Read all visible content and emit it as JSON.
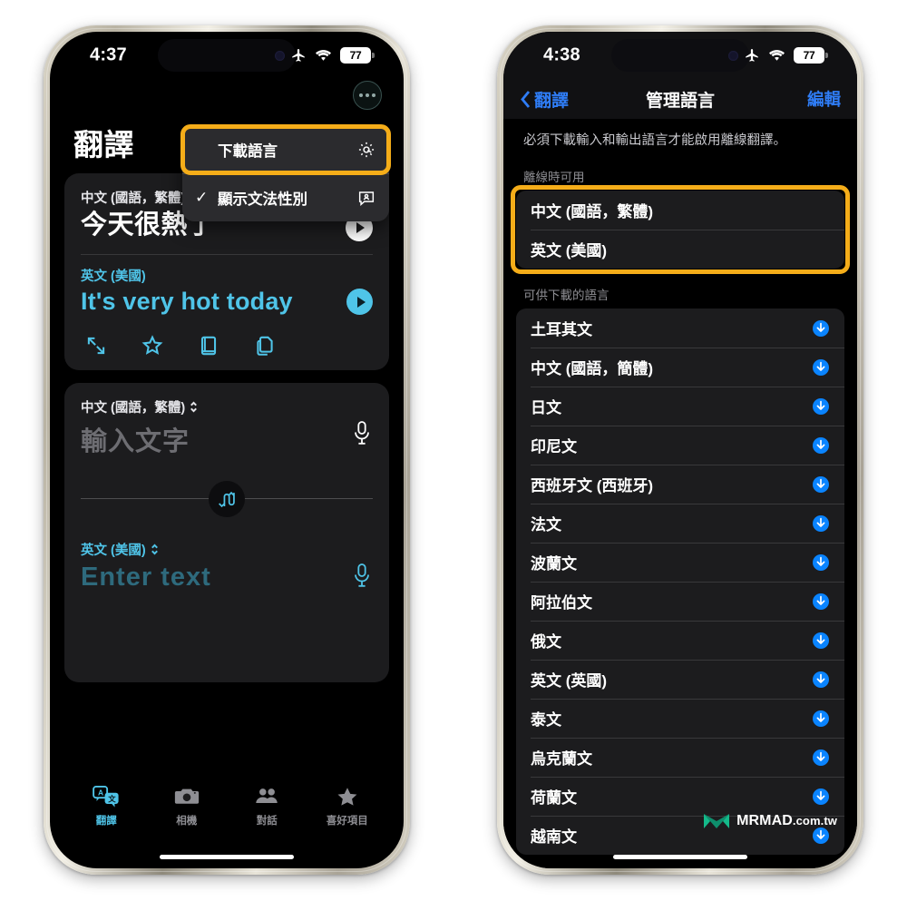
{
  "left_phone": {
    "status_bar": {
      "time": "4:37",
      "airplane_icon": "airplane-icon",
      "wifi_icon": "wifi-icon",
      "battery": "77"
    },
    "app": {
      "title": "翻譯",
      "more_button": "more-options-icon",
      "context_menu": {
        "items": [
          {
            "label": "下載語言",
            "icon": "gear-icon",
            "checked": false,
            "highlighted": true
          },
          {
            "label": "顯示文法性別",
            "icon": "speech-person-icon",
            "checked": true,
            "check_glyph": "✓"
          }
        ]
      },
      "result_card": {
        "source_language": "中文 (國語，繁體)",
        "source_text": "今天很熱了",
        "source_play_icon": "play-icon",
        "target_language": "英文 (美國)",
        "target_text": "It's very hot today",
        "target_play_icon": "play-icon",
        "actions": [
          "expand-icon",
          "star-icon",
          "dictionary-icon",
          "copy-icon"
        ]
      },
      "input_card": {
        "source_language": "中文 (國語，繁體)",
        "source_placeholder": "輸入文字",
        "source_mic_icon": "microphone-icon",
        "swap_icon": "swap-languages-icon",
        "target_language": "英文 (美國)",
        "target_placeholder": "Enter text",
        "target_mic_icon": "microphone-icon"
      },
      "tabs": [
        {
          "label": "翻譯",
          "icon": "translate-icon",
          "active": true
        },
        {
          "label": "相機",
          "icon": "camera-icon",
          "active": false
        },
        {
          "label": "對話",
          "icon": "conversation-icon",
          "active": false
        },
        {
          "label": "喜好項目",
          "icon": "star-icon",
          "active": false
        }
      ]
    }
  },
  "right_phone": {
    "status_bar": {
      "time": "4:38",
      "airplane_icon": "airplane-icon",
      "wifi_icon": "wifi-icon",
      "battery": "77"
    },
    "nav": {
      "back_label": "翻譯",
      "back_icon": "chevron-left-icon",
      "title": "管理語言",
      "edit_label": "編輯"
    },
    "notice": "必須下載輸入和輸出語言才能啟用離線翻譯。",
    "offline_section": {
      "header": "離線時可用",
      "highlighted": true,
      "items": [
        {
          "label": "中文 (國語，繁體)"
        },
        {
          "label": "英文 (美國)"
        }
      ]
    },
    "available_section": {
      "header": "可供下載的語言",
      "items": [
        {
          "label": "土耳其文",
          "icon": "download-icon"
        },
        {
          "label": "中文 (國語，簡體)",
          "icon": "download-icon"
        },
        {
          "label": "日文",
          "icon": "download-icon"
        },
        {
          "label": "印尼文",
          "icon": "download-icon"
        },
        {
          "label": "西班牙文 (西班牙)",
          "icon": "download-icon"
        },
        {
          "label": "法文",
          "icon": "download-icon"
        },
        {
          "label": "波蘭文",
          "icon": "download-icon"
        },
        {
          "label": "阿拉伯文",
          "icon": "download-icon"
        },
        {
          "label": "俄文",
          "icon": "download-icon"
        },
        {
          "label": "英文 (英國)",
          "icon": "download-icon"
        },
        {
          "label": "泰文",
          "icon": "download-icon"
        },
        {
          "label": "烏克蘭文",
          "icon": "download-icon"
        },
        {
          "label": "荷蘭文",
          "icon": "download-icon"
        },
        {
          "label": "越南文",
          "icon": "download-icon"
        }
      ]
    }
  },
  "watermark": {
    "name": "MRMAD",
    "suffix": ".com.tw",
    "logo": "mrmad-logo-icon"
  },
  "colors": {
    "highlight": "#f5ad19",
    "accent_cyan": "#4fc4e8",
    "accent_blue": "#2f7df6",
    "card": "#1c1c1e",
    "background": "#000000"
  }
}
